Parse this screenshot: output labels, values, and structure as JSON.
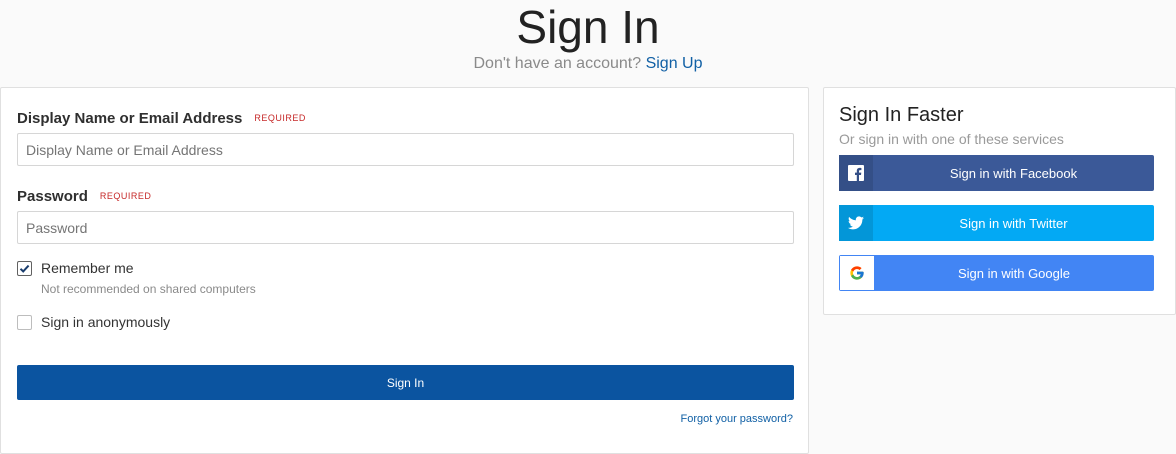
{
  "header": {
    "title": "Sign In",
    "subtitle_text": "Don't have an account?",
    "signup_link": "Sign Up"
  },
  "form": {
    "username": {
      "label": "Display Name or Email Address",
      "required": "REQUIRED",
      "placeholder": "Display Name or Email Address",
      "value": ""
    },
    "password": {
      "label": "Password",
      "required": "REQUIRED",
      "placeholder": "Password",
      "value": ""
    },
    "remember_me": {
      "label": "Remember me",
      "hint": "Not recommended on shared computers",
      "checked": true
    },
    "anonymous": {
      "label": "Sign in anonymously",
      "checked": false
    },
    "submit_label": "Sign In",
    "forgot_link": "Forgot your password?"
  },
  "social": {
    "title": "Sign In Faster",
    "subtitle": "Or sign in with one of these services",
    "buttons": [
      {
        "label": "Sign in with Facebook",
        "icon": "facebook-icon",
        "color": "#3b5998"
      },
      {
        "label": "Sign in with Twitter",
        "icon": "twitter-icon",
        "color": "#03a9f4"
      },
      {
        "label": "Sign in with Google",
        "icon": "google-icon",
        "color": "#4285f4"
      }
    ]
  },
  "colors": {
    "accent": "#0b54a0",
    "link": "#1160a5",
    "required": "#c62828"
  }
}
